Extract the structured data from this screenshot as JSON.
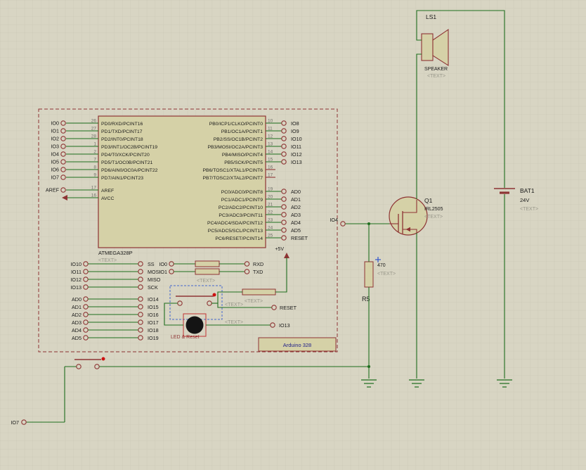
{
  "colors": {
    "background": "#d8d5c3",
    "grid": "#cbc8b6",
    "wire": "#1e6e1e",
    "component": "#8e3434",
    "fill": "#d5d1a7",
    "text": "#1a1a1a",
    "pin_number": "#70706a",
    "placeholder": "#98978a",
    "subcircuit_label": "#20208a",
    "selection": "#4466cc",
    "marker_red": "#cc1111",
    "marker_blue": "#3355cc"
  },
  "chip": {
    "name": "ATMEGA328P",
    "placeholder": "<TEXT>",
    "left_pins": [
      {
        "ext": "IO0",
        "num": "26",
        "name": "PD0/RXD/PCINT16"
      },
      {
        "ext": "IO1",
        "num": "27",
        "name": "PD1/TXD/PCINT17"
      },
      {
        "ext": "IO2",
        "num": "28",
        "name": "PD2/INT0/PCINT18"
      },
      {
        "ext": "IO3",
        "num": "1",
        "name": "PD3/INT1/OC2B/PCINT19"
      },
      {
        "ext": "IO4",
        "num": "2",
        "name": "PD4/T0/XCK/PCINT20"
      },
      {
        "ext": "IO5",
        "num": "7",
        "name": "PD5/T1/OC0B/PCINT21"
      },
      {
        "ext": "IO6",
        "num": "8",
        "name": "PD6/AIN0/OC0A/PCINT22"
      },
      {
        "ext": "IO7",
        "num": "9",
        "name": "PD7/AIN1/PCINT23"
      }
    ],
    "aref": {
      "ext": "AREF",
      "num": "17",
      "name": "AREF"
    },
    "avcc": {
      "num": "16",
      "name": "AVCC"
    },
    "right_top_pins": [
      {
        "num": "10",
        "name": "PB0/ICP1/CLKO/PCINT0",
        "ext": "IO8"
      },
      {
        "num": "11",
        "name": "PB1/OC1A/PCINT1",
        "ext": "IO9"
      },
      {
        "num": "12",
        "name": "PB2/SS/OC1B/PCINT2",
        "ext": "IO10"
      },
      {
        "num": "13",
        "name": "PB3/MOSI/OC2A/PCINT3",
        "ext": "IO11"
      },
      {
        "num": "14",
        "name": "PB4/MISO/PCINT4",
        "ext": "IO12"
      },
      {
        "num": "15",
        "name": "PB5/SCK/PCINT5",
        "ext": "IO13"
      },
      {
        "num": "16",
        "name": "PB6/TOSC1/XTAL1/PCINT6",
        "ext": ""
      },
      {
        "num": "17",
        "name": "PB7/TOSC2/XTAL2/PCINT7",
        "ext": ""
      }
    ],
    "right_bottom_pins": [
      {
        "num": "19",
        "name": "PC0/ADC0/PCINT8",
        "ext": "AD0"
      },
      {
        "num": "20",
        "name": "PC1/ADC1/PCINT9",
        "ext": "AD1"
      },
      {
        "num": "21",
        "name": "PC2/ADC2/PCINT10",
        "ext": "AD2"
      },
      {
        "num": "22",
        "name": "PC3/ADC3/PCINT11",
        "ext": "AD3"
      },
      {
        "num": "23",
        "name": "PC4/ADC4/SDA/PCINT12",
        "ext": "AD4"
      },
      {
        "num": "24",
        "name": "PC5/ADC5/SCL/PCINT13",
        "ext": "AD5"
      },
      {
        "num": "25",
        "name": "PC6/RESET/PCINT14",
        "ext": "RESET"
      }
    ]
  },
  "subcircuit": {
    "label": "Arduino 328"
  },
  "spi_rows": [
    {
      "left": "IO10",
      "right": "SS"
    },
    {
      "left": "IO11",
      "right": "MOSI"
    },
    {
      "left": "IO12",
      "right": "MISO"
    },
    {
      "left": "IO13",
      "right": "SCK"
    }
  ],
  "uart_rows": [
    {
      "left": "IO0",
      "right": "RXD"
    },
    {
      "left": "IO1",
      "right": "TXD"
    }
  ],
  "uart_placeholder": "<TEXT>",
  "analog_rows": [
    {
      "left": "AD0",
      "right": "IO14"
    },
    {
      "left": "AD1",
      "right": "IO15"
    },
    {
      "left": "AD2",
      "right": "IO16"
    },
    {
      "left": "AD3",
      "right": "IO17"
    },
    {
      "left": "AD4",
      "right": "IO18"
    },
    {
      "left": "AD5",
      "right": "IO19"
    }
  ],
  "reset_group": {
    "power": "+5V",
    "resistor_placeholder": "<TEXT>",
    "button_placeholder": "<TEXT>",
    "led_placeholder": "<TEXT>",
    "reset": "RESET",
    "io": "IO13",
    "caption": "LED & Reset"
  },
  "speaker": {
    "ref": "LS1",
    "label": "SPEAKER",
    "placeholder": "<TEXT>"
  },
  "mosfet": {
    "ref": "Q1",
    "value": "IRL2505",
    "placeholder": "<TEXT>",
    "gate": "IO4"
  },
  "resistor_r5": {
    "value": "470",
    "placeholder": "<TEXT>",
    "ref": "R5"
  },
  "battery": {
    "ref": "BAT1",
    "value": "24V",
    "placeholder": "<TEXT>"
  },
  "io7": "IO7"
}
